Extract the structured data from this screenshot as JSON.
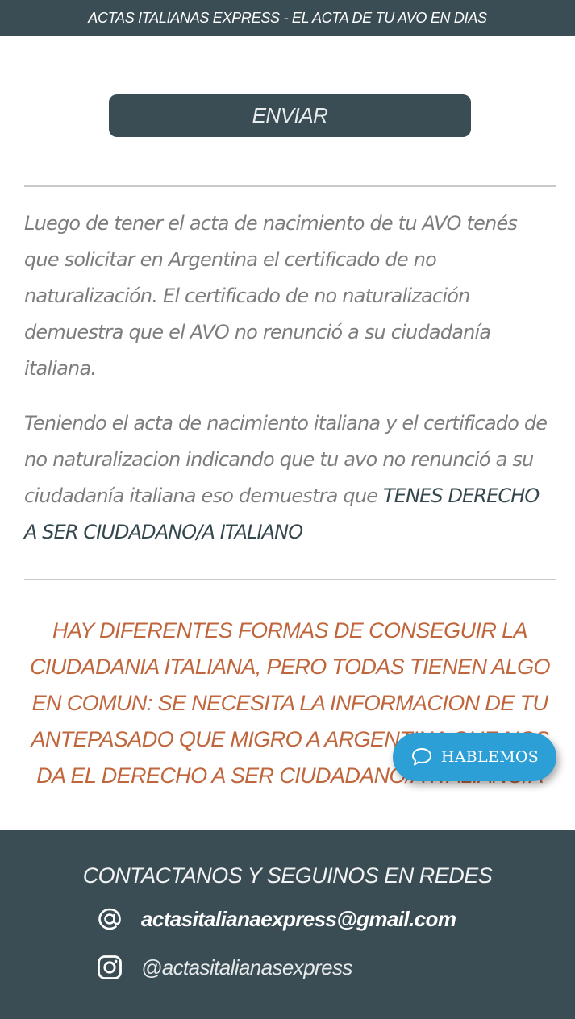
{
  "header": {
    "banner_text": "ACTAS ITALIANAS EXPRESS - EL ACTA DE TU AVO EN DIAS"
  },
  "form": {
    "submit_label": "ENVIAR"
  },
  "content": {
    "paragraph_1": "Luego de tener el acta de nacimiento de tu AVO tenés que solicitar en Argentina el certificado de no naturalización. El certificado de no naturalización demuestra que el AVO no renunció a su ciudadanía italiana.",
    "paragraph_2_lead": "Teniendo el acta de nacimiento italiana y el certificado de no naturalizacion indicando que tu avo no renunció a su ciudadanía italiana eso demuestra que ",
    "paragraph_2_highlight": "TENES DERECHO A SER CIUDADANO/A ITALIANO",
    "notice": "HAY DIFERENTES FORMAS DE CONSEGUIR LA CIUDADANIA ITALIANA, PERO TODAS TIENEN ALGO EN COMUN: SE NECESITA LA INFORMACION DE TU ANTEPASADO QUE MIGRO A ARGENTINA QUE NOS DA EL DERECHO A SER CIUDADANO/A ITALIANO/A"
  },
  "chat_widget": {
    "label": "HABLEMOS",
    "icon": "chat-bubble-icon"
  },
  "footer": {
    "title": "CONTACTANOS Y SEGUINOS EN REDES",
    "email": "actasitalianaexpress@gmail.com",
    "instagram": "@actasitalianasexpress"
  },
  "colors": {
    "primary_dark": "#3b4d54",
    "body_text": "#7d7d7d",
    "accent_orange": "#c0663c",
    "chat_blue": "#2c9fd6"
  }
}
